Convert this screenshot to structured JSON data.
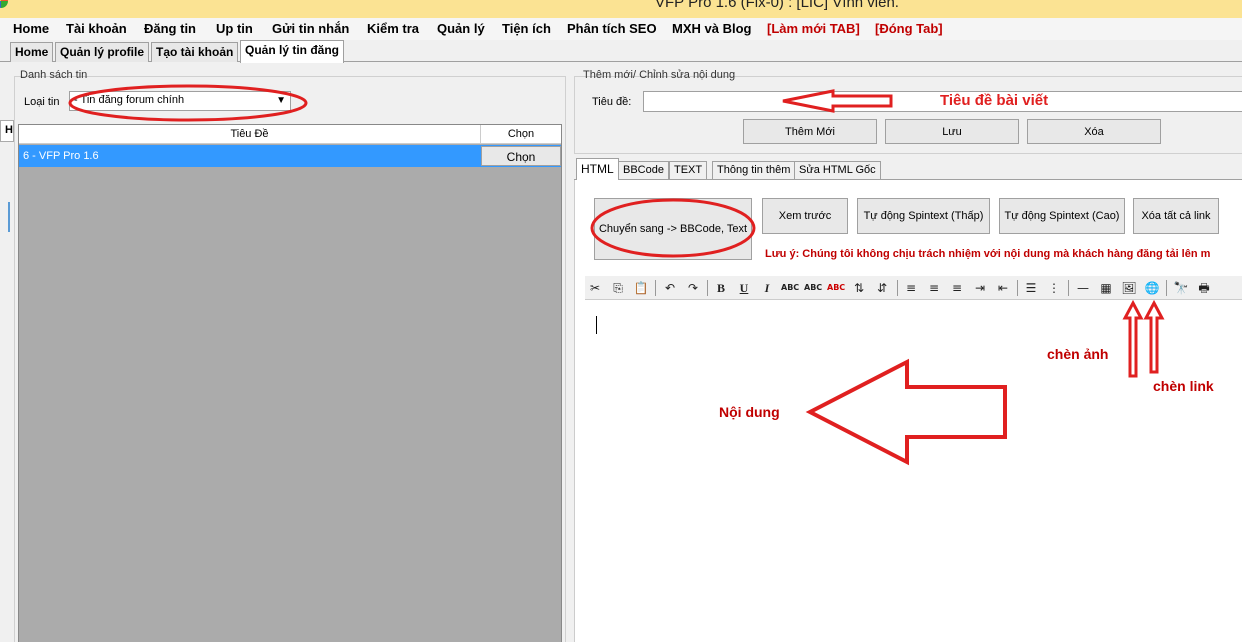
{
  "window": {
    "title": "VFP Pro 1.6 (Fix-0) : [LIC] Vĩnh viễn."
  },
  "menu": {
    "items": [
      "Home",
      "Tài khoản",
      "Đăng tin",
      "Up tin",
      "Gửi tin nhắn",
      "Kiểm tra",
      "Quản lý",
      "Tiện ích",
      "Phân tích SEO",
      "MXH và Blog"
    ],
    "refresh_tab": "[Làm mới TAB]",
    "close_tab": "[Đóng Tab]"
  },
  "tabs": [
    "Home",
    "Quản lý profile",
    "Tạo tài khoản",
    "Quản lý tin đăng"
  ],
  "left": {
    "group_label": "Danh sách tin",
    "type_label": "Loại tin",
    "type_value": "- Tin đăng forum chính",
    "edge_tab": "H",
    "grid": {
      "columns": [
        "Tiêu Đề",
        "Chọn"
      ],
      "rows": [
        {
          "title": "6 - VFP Pro 1.6",
          "action": "Chọn"
        }
      ]
    }
  },
  "right": {
    "group_label": "Thêm mới/ Chỉnh sửa nội dung",
    "title_label": "Tiêu đề:",
    "title_value": "",
    "buttons": {
      "add": "Thêm Mới",
      "save": "Lưu",
      "delete": "Xóa"
    },
    "editor_tabs": [
      "HTML",
      "BBCode",
      "TEXT",
      "Thông tin thêm",
      "Sửa HTML Gốc"
    ],
    "actions": {
      "convert": "Chuyển sang -> BBCode, Text",
      "preview": "Xem trước",
      "spin_low": "Tự động Spintext (Thấp)",
      "spin_high": "Tự động Spintext (Cao)",
      "remove_links": "Xóa tất cả link"
    },
    "note": "Lưu ý: Chúng tôi không chịu trách nhiệm với nội dung mà khách hàng đăng tải lên m",
    "editor_content": ""
  },
  "toolbar_glyphs": {
    "bold": "B",
    "underline": "U",
    "italic": "I",
    "strike": "ABC",
    "sub": "ABC",
    "sup": "ABC"
  },
  "annotations": {
    "title_hint": "Tiêu đề bài viết",
    "content_hint": "Nội dung",
    "insert_image": "chèn ảnh",
    "insert_link": "chèn link"
  },
  "colors": {
    "titlebar": "#fbe393",
    "selection": "#3399ff",
    "annotation": "#e02020",
    "grid_bg": "#ababab"
  }
}
